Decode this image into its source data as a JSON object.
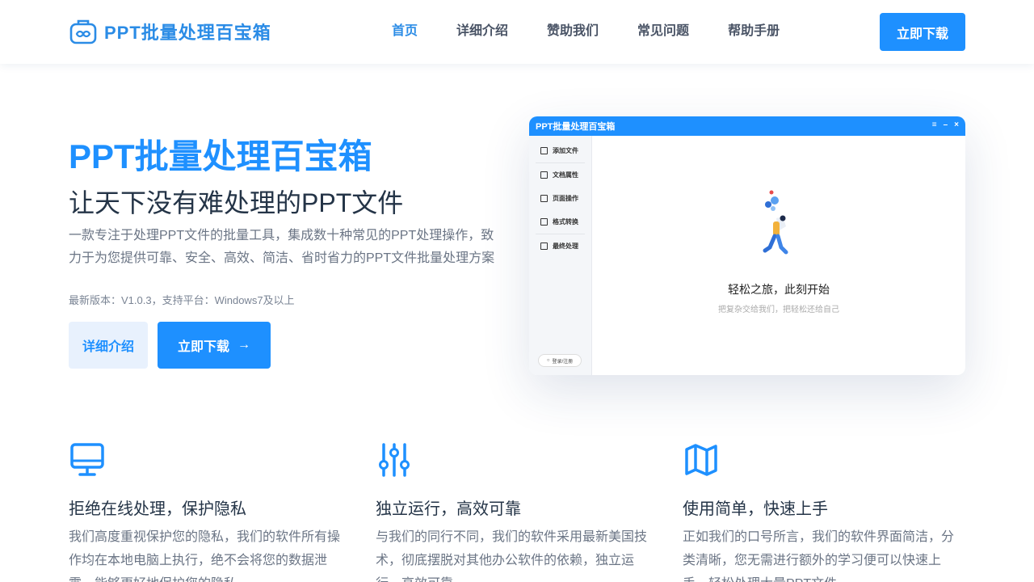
{
  "header": {
    "logo_text": "PPT批量处理百宝箱",
    "nav": [
      "首页",
      "详细介绍",
      "赞助我们",
      "常见问题",
      "帮助手册"
    ],
    "download_label": "立即下载"
  },
  "hero": {
    "title": "PPT批量处理百宝箱",
    "subtitle": "让天下没有难处理的PPT文件",
    "description": "一款专注于处理PPT文件的批量工具，集成数十种常见的PPT处理操作，致力于为您提供可靠、安全、高效、简洁、省时省力的PPT文件批量处理方案",
    "version": "最新版本：V1.0.3，支持平台：Windows7及以上",
    "detail_label": "详细介绍",
    "download_label": "立即下载",
    "arrow": "→"
  },
  "app_mock": {
    "title": "PPT批量处理百宝箱",
    "controls": [
      "≡",
      "–",
      "×"
    ],
    "sidebar": [
      "添加文件",
      "文档属性",
      "页面操作",
      "格式转换",
      "最终处理"
    ],
    "login": "登录/注册",
    "empty_title": "轻松之旅，此刻开始",
    "empty_sub": "把复杂交给我们，把轻松还给自己"
  },
  "features": [
    {
      "icon": "monitor-icon",
      "title": "拒绝在线处理，保护隐私",
      "text": "我们高度重视保护您的隐私，我们的软件所有操作均在本地电脑上执行，绝不会将您的数据泄露，能够更好地保护您的隐私"
    },
    {
      "icon": "sliders-icon",
      "title": "独立运行，高效可靠",
      "text": "与我们的同行不同，我们的软件采用最新美国技术，彻底摆脱对其他办公软件的依赖，独立运行，高效可靠"
    },
    {
      "icon": "map-icon",
      "title": "使用简单，快速上手",
      "text": "正如我们的口号所言，我们的软件界面简洁，分类清晰，您无需进行额外的学习便可以快速上手，轻松处理大量PPT文件"
    }
  ],
  "colors": {
    "accent": "#1e90ff",
    "logo": "#2b8ce6"
  }
}
